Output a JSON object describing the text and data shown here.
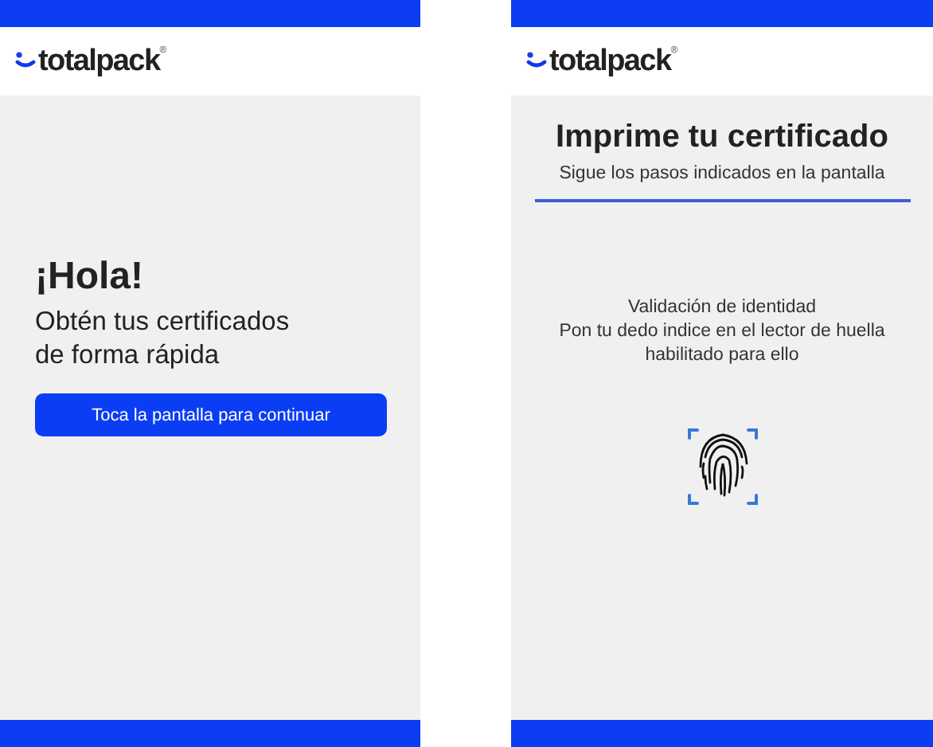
{
  "screens": [
    {
      "kind": "welcome",
      "logo": {
        "text": "totalpack",
        "mark": "®"
      },
      "greeting": "¡Hola!",
      "message": [
        "Obtén tus certificados",
        "de forma rápida"
      ],
      "button": "Toca la pantalla para continuar"
    },
    {
      "kind": "fingerprint",
      "logo": {
        "text": "totalpack",
        "mark": "®"
      },
      "title": "Imprime tu certificado",
      "subtitle": "Sigue los pasos indicados en la pantalla",
      "instructions": [
        "Validación de identidad",
        "Pon tu dedo indice en el lector de huella",
        "habilitado para ello"
      ]
    }
  ]
}
